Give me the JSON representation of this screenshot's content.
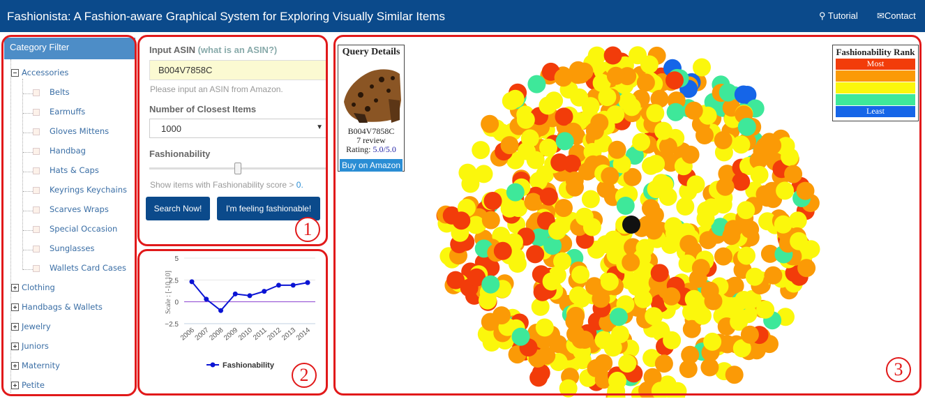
{
  "header": {
    "title": "Fashionista: A Fashion-aware Graphical System for Exploring Visually Similar Items",
    "tutorial": "Tutorial",
    "contact": "Contact"
  },
  "sidebar": {
    "title": "Category Filter",
    "root": "Accessories",
    "children": [
      "Belts",
      "Earmuffs",
      "Gloves Mittens",
      "Handbag",
      "Hats & Caps",
      "Keyrings Keychains",
      "Scarves Wraps",
      "Special Occasion",
      "Sunglasses",
      "Wallets Card Cases"
    ],
    "collapsed": [
      "Clothing",
      "Handbags & Wallets",
      "Jewelry",
      "Juniors",
      "Maternity",
      "Petite"
    ]
  },
  "form": {
    "asin_label": "Input ASIN",
    "asin_help": "(what is an ASIN?)",
    "asin_value": "B004V7858C",
    "asin_hint": "Please input an ASIN from Amazon.",
    "closest_label": "Number of Closest Items",
    "closest_value": "1000",
    "fashion_label": "Fashionability",
    "slider_value": 0.5,
    "score_hint": "Show items with Fashionability score >",
    "score_value": "0.",
    "search_button": "Search Now!",
    "feeling_button": "I'm feeling fashionable!"
  },
  "panels": {
    "one": "1",
    "two": "2",
    "three": "3"
  },
  "chart_data": {
    "type": "line",
    "x": [
      "2006",
      "2007",
      "2008",
      "2009",
      "2010",
      "2011",
      "2012",
      "2013",
      "2014"
    ],
    "series": [
      {
        "name": "Fashionability",
        "values": [
          2.3,
          0.3,
          -1.0,
          0.9,
          0.7,
          1.2,
          1.9,
          1.9,
          2.2
        ],
        "color": "#0b14d4"
      }
    ],
    "ylabel": "Scale : [-10,10]",
    "ylim": [
      -2.5,
      5
    ],
    "yticks": [
      "5",
      "2.5",
      "0",
      "−2.5"
    ],
    "zero_line_color": "#8a3fcf",
    "legend": "bottom"
  },
  "query": {
    "title": "Query Details",
    "asin": "B004V7858C",
    "reviews": "7 review",
    "rating_label": "Rating:",
    "rating_value": "5.0/5.0",
    "buy": "Buy on Amazon"
  },
  "legend": {
    "title": "Fashionability Rank",
    "most": "Most",
    "least": "Least",
    "colors": [
      "#f23c0a",
      "#fb9a06",
      "#fbf70c",
      "#3ee89a",
      "#1565e8"
    ]
  }
}
